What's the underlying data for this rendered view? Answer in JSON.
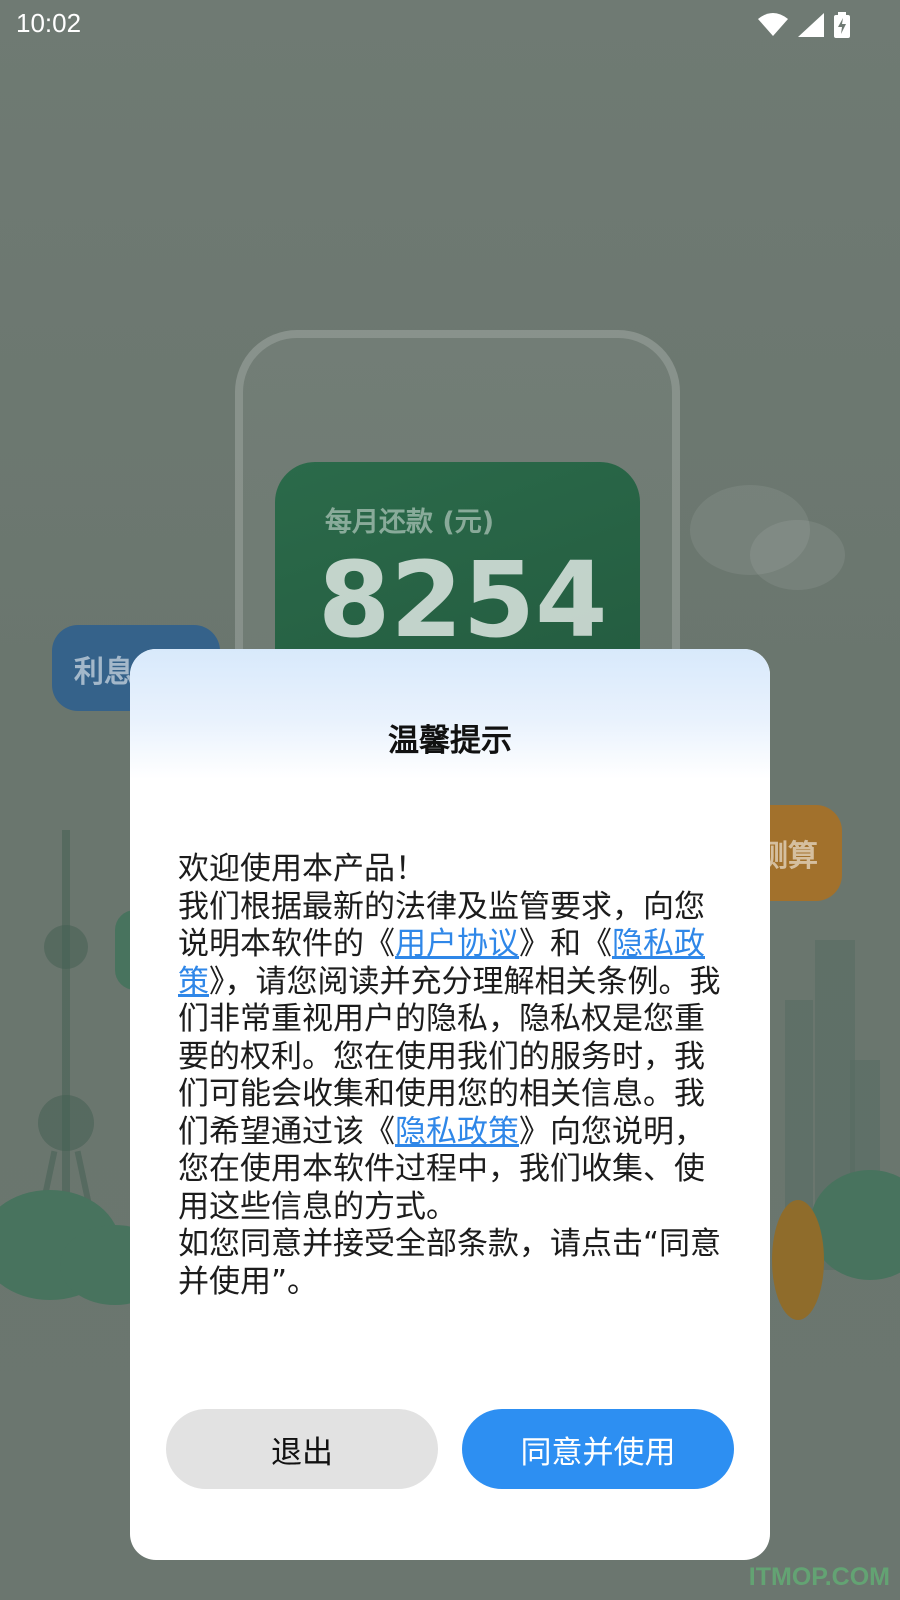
{
  "status_bar": {
    "time": "10:02",
    "icons": [
      "wifi-icon",
      "cellular-signal-icon",
      "battery-charging-icon"
    ]
  },
  "background": {
    "card_label": "每月还款 (元)",
    "card_value": "8254",
    "bubble_left": "利息",
    "bubble_right": "测算"
  },
  "dialog": {
    "title": "温馨提示",
    "p1": "欢迎使用本产品！",
    "p2_a": "我们根据最新的法律及监管要求，向您说明本软件的《",
    "link_user_agreement": "用户协议",
    "p2_b": "》和《",
    "link_privacy_policy": "隐私政策",
    "p2_c": "》，请您阅读并充分理解相关条例。我们非常重视用户的隐私，隐私权是您重要的权利。您在使用我们的服务时，我们可能会收集和使用您的相关信息。我们希望通过该《",
    "link_privacy_policy_2": "隐私政策",
    "p2_d": "》向您说明，您在使用本软件过程中，我们收集、使用这些信息的方式。",
    "p3": "如您同意并接受全部条款，请点击“同意并使用”。",
    "exit_label": "退出",
    "agree_label": "同意并使用"
  },
  "watermark": "ITMOP.COM",
  "colors": {
    "accent": "#2d8ff2",
    "link": "#2f87e8",
    "exit_button_bg": "#e2e2e2",
    "overlay": "#6f7a73"
  }
}
